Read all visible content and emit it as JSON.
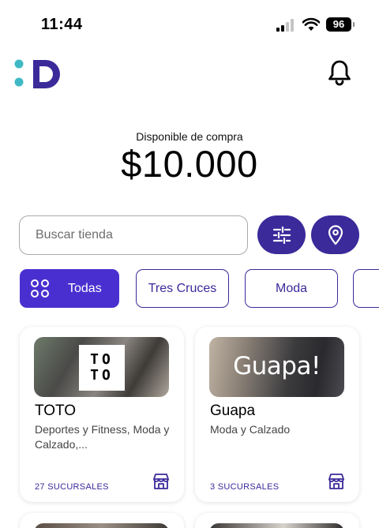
{
  "status_bar": {
    "time": "11:44",
    "battery": "96"
  },
  "header": {
    "logo_name": "D-logo",
    "notification_icon": "bell-icon"
  },
  "balance": {
    "label": "Disponible de compra",
    "amount": "$10.000"
  },
  "search": {
    "placeholder": "Buscar tienda",
    "value": ""
  },
  "actions": {
    "filter_icon": "sliders-icon",
    "location_icon": "location-pin-icon"
  },
  "categories": [
    {
      "label": "Todas",
      "selected": true,
      "icon": "grid-icon"
    },
    {
      "label": "Tres Cruces",
      "selected": false
    },
    {
      "label": "Moda",
      "selected": false
    }
  ],
  "stores": [
    {
      "name": "TOTO",
      "logo_text": "TOTO",
      "description": "Deportes y Fitness, Moda y Calzado,...",
      "branches": "27 SUCURSALES",
      "icon": "store-icon"
    },
    {
      "name": "Guapa",
      "logo_text": "Guapa!",
      "description": "Moda y Calzado",
      "branches": "3 SUCURSALES",
      "icon": "store-icon"
    }
  ],
  "colors": {
    "primary": "#3b2a9a",
    "chip_active": "#4a2fd0",
    "logo_dots": "#3fb9c5"
  }
}
